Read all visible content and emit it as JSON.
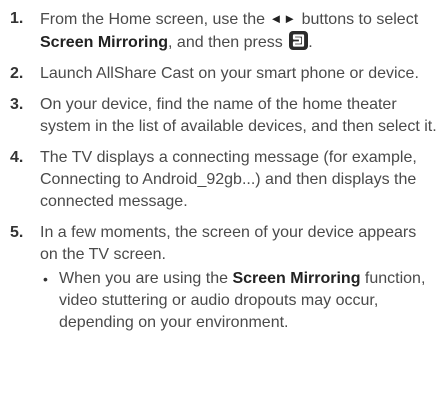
{
  "steps": [
    {
      "number": "1.",
      "parts": {
        "a": "From the Home screen, use the ",
        "arrows": "◄►",
        "b": " buttons to select ",
        "target": "Screen Mirroring",
        "c": ", and then press ",
        "d": "."
      }
    },
    {
      "number": "2.",
      "text": "Launch AllShare Cast on your smart phone or device."
    },
    {
      "number": "3.",
      "text": "On your device, find the name of the home theater system in the list of available devices, and then select it."
    },
    {
      "number": "4.",
      "text": "The TV displays a connecting message (for example, Connecting to Android_92gb...) and then displays the connected message."
    },
    {
      "number": "5.",
      "text": "In a few moments, the screen of your device appears on the TV screen.",
      "bullet": {
        "a": "When you are using the ",
        "bold": "Screen Mirroring",
        "b": " function, video stuttering or audio dropouts may occur, depending on your environment."
      }
    }
  ],
  "icons": {
    "enter": "enter-button-icon",
    "bullet": "bullet-dot-icon"
  }
}
